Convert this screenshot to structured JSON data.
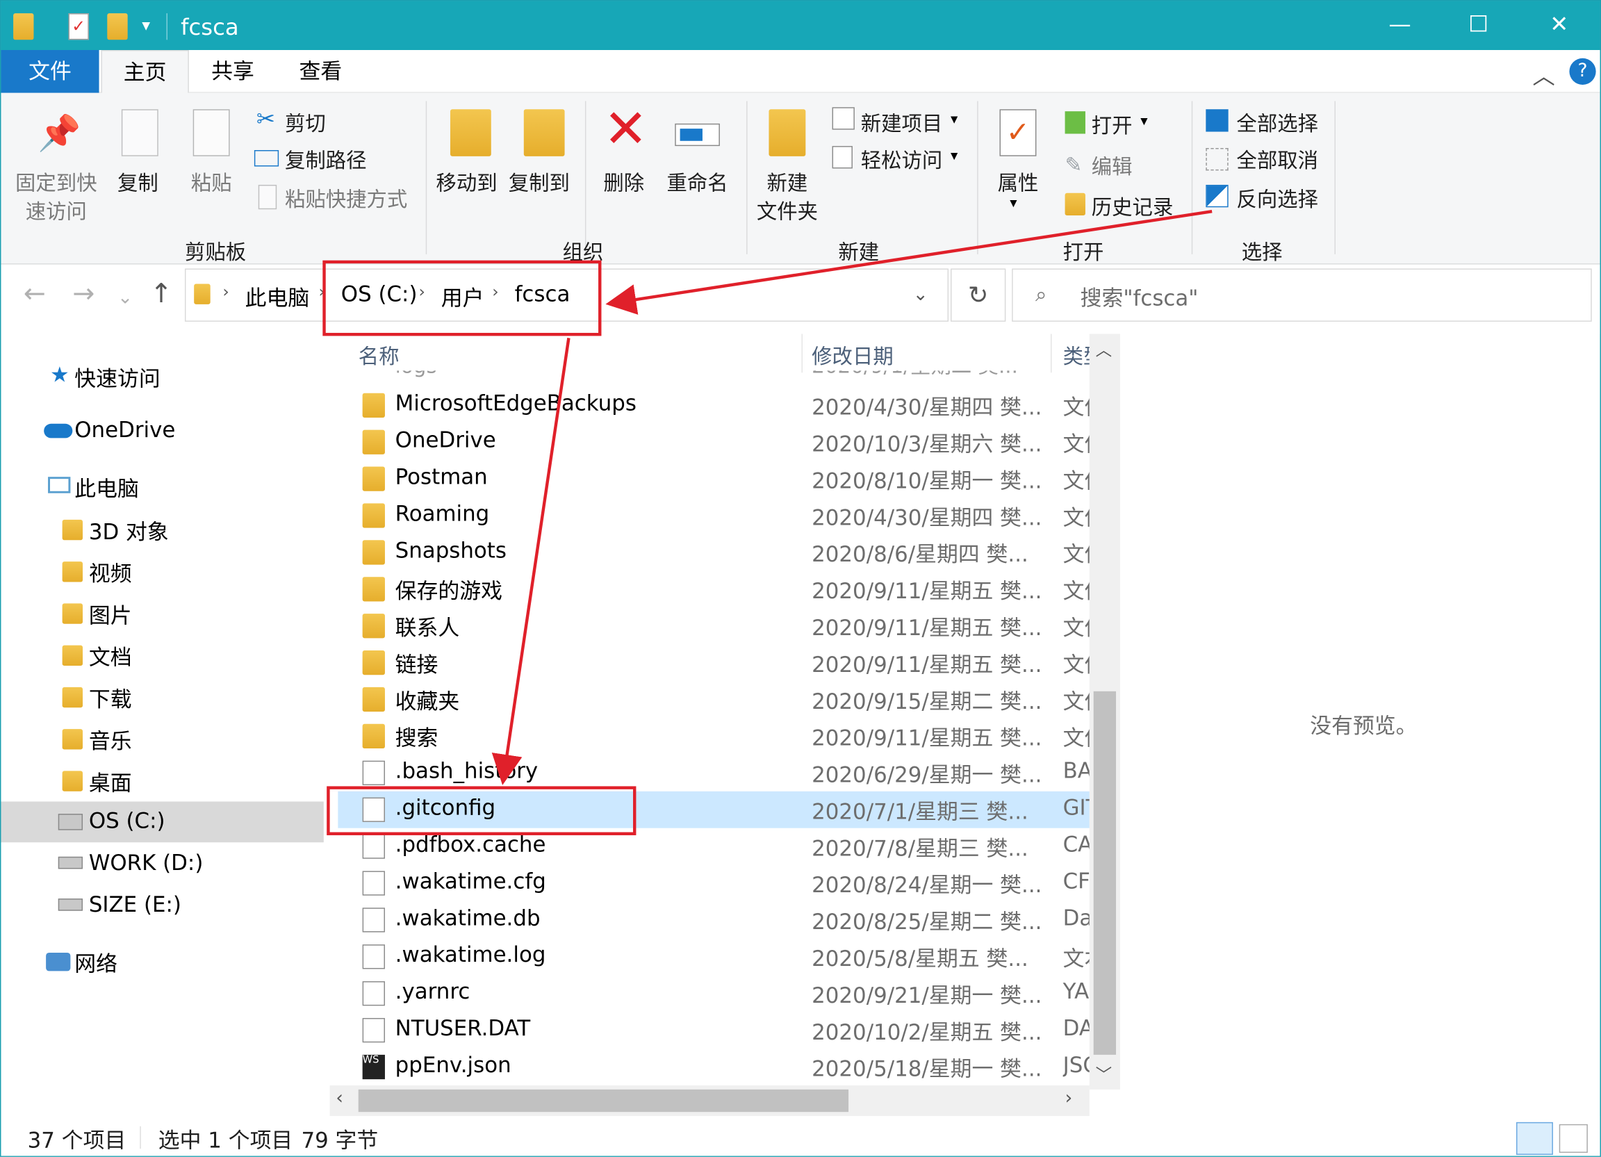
{
  "window": {
    "title": "fcsca",
    "minimize": "—",
    "maximize": "☐",
    "close": "✕"
  },
  "tabs": {
    "file": "文件",
    "home": "主页",
    "share": "共享",
    "view": "查看"
  },
  "ribbon": {
    "pin": [
      "固定到快",
      "速访问"
    ],
    "copy": "复制",
    "paste": "粘贴",
    "cut": "剪切",
    "copy_path": "复制路径",
    "paste_shortcut": "粘贴快捷方式",
    "clipboard_group": "剪贴板",
    "move_to": "移动到",
    "copy_to": "复制到",
    "delete": "删除",
    "rename": "重命名",
    "organize_group": "组织",
    "new_folder": [
      "新建",
      "文件夹"
    ],
    "new_item": "新建项目",
    "easy_access": "轻松访问",
    "new_group": "新建",
    "properties": "属性",
    "open": "打开",
    "edit": "编辑",
    "history": "历史记录",
    "open_group": "打开",
    "select_all": "全部选择",
    "select_none": "全部取消",
    "invert_selection": "反向选择",
    "select_group": "选择"
  },
  "address": {
    "crumbs": [
      "此电脑",
      "OS (C:)",
      "用户",
      "fcsca"
    ],
    "search_placeholder": "搜索\"fcsca\""
  },
  "sidebar": {
    "quick_access": "快速访问",
    "onedrive": "OneDrive",
    "this_pc": "此电脑",
    "items": [
      "3D 对象",
      "视频",
      "图片",
      "文档",
      "下载",
      "音乐",
      "桌面",
      "OS (C:)",
      "WORK (D:)",
      "SIZE (E:)"
    ],
    "network": "网络"
  },
  "columns": {
    "name": "名称",
    "modified": "修改日期",
    "type": "类型"
  },
  "files": [
    {
      "name": "MicrosoftEdgeBackups",
      "date": "2020/4/30/星期四 樊...",
      "type": "文件夹",
      "kind": "folder"
    },
    {
      "name": "OneDrive",
      "date": "2020/10/3/星期六 樊...",
      "type": "文件夹",
      "kind": "folder"
    },
    {
      "name": "Postman",
      "date": "2020/8/10/星期一 樊...",
      "type": "文件夹",
      "kind": "folder"
    },
    {
      "name": "Roaming",
      "date": "2020/4/30/星期四 樊...",
      "type": "文件夹",
      "kind": "folder"
    },
    {
      "name": "Snapshots",
      "date": "2020/8/6/星期四 樊...",
      "type": "文件夹",
      "kind": "folder"
    },
    {
      "name": "保存的游戏",
      "date": "2020/9/11/星期五 樊...",
      "type": "文件夹",
      "kind": "folder"
    },
    {
      "name": "联系人",
      "date": "2020/9/11/星期五 樊...",
      "type": "文件夹",
      "kind": "folder"
    },
    {
      "name": "链接",
      "date": "2020/9/11/星期五 樊...",
      "type": "文件夹",
      "kind": "folder"
    },
    {
      "name": "收藏夹",
      "date": "2020/9/15/星期二 樊...",
      "type": "文件夹",
      "kind": "folder"
    },
    {
      "name": "搜索",
      "date": "2020/9/11/星期五 樊...",
      "type": "文件夹",
      "kind": "folder"
    },
    {
      "name": ".bash_history",
      "date": "2020/6/29/星期一 樊...",
      "type": "BASH_HISTORY",
      "kind": "file"
    },
    {
      "name": ".gitconfig",
      "date": "2020/7/1/星期三 樊...",
      "type": "GITCONFIG",
      "kind": "file"
    },
    {
      "name": ".pdfbox.cache",
      "date": "2020/7/8/星期三 樊...",
      "type": "CACHE",
      "kind": "file"
    },
    {
      "name": ".wakatime.cfg",
      "date": "2020/8/24/星期一 樊...",
      "type": "CFG",
      "kind": "file"
    },
    {
      "name": ".wakatime.db",
      "date": "2020/8/25/星期二 樊...",
      "type": "Data",
      "kind": "file"
    },
    {
      "name": ".wakatime.log",
      "date": "2020/5/8/星期五 樊...",
      "type": "文本",
      "kind": "file"
    },
    {
      "name": ".yarnrc",
      "date": "2020/9/21/星期一 樊...",
      "type": "YARNRC",
      "kind": "file"
    },
    {
      "name": "NTUSER.DAT",
      "date": "2020/10/2/星期五 樊...",
      "type": "DAT",
      "kind": "file"
    },
    {
      "name": "ppEnv.json",
      "date": "2020/5/18/星期一 樊...",
      "type": "JSON",
      "kind": "ws"
    }
  ],
  "preview": "没有预览。",
  "status": {
    "count": "37 个项目",
    "selected": "选中 1 个项目",
    "size": "79 字节"
  },
  "colors": {
    "titlebar": "#17a7b7",
    "file_tab": "#1979ca",
    "selected_row": "#cce8ff",
    "annotation": "#e0202a"
  }
}
